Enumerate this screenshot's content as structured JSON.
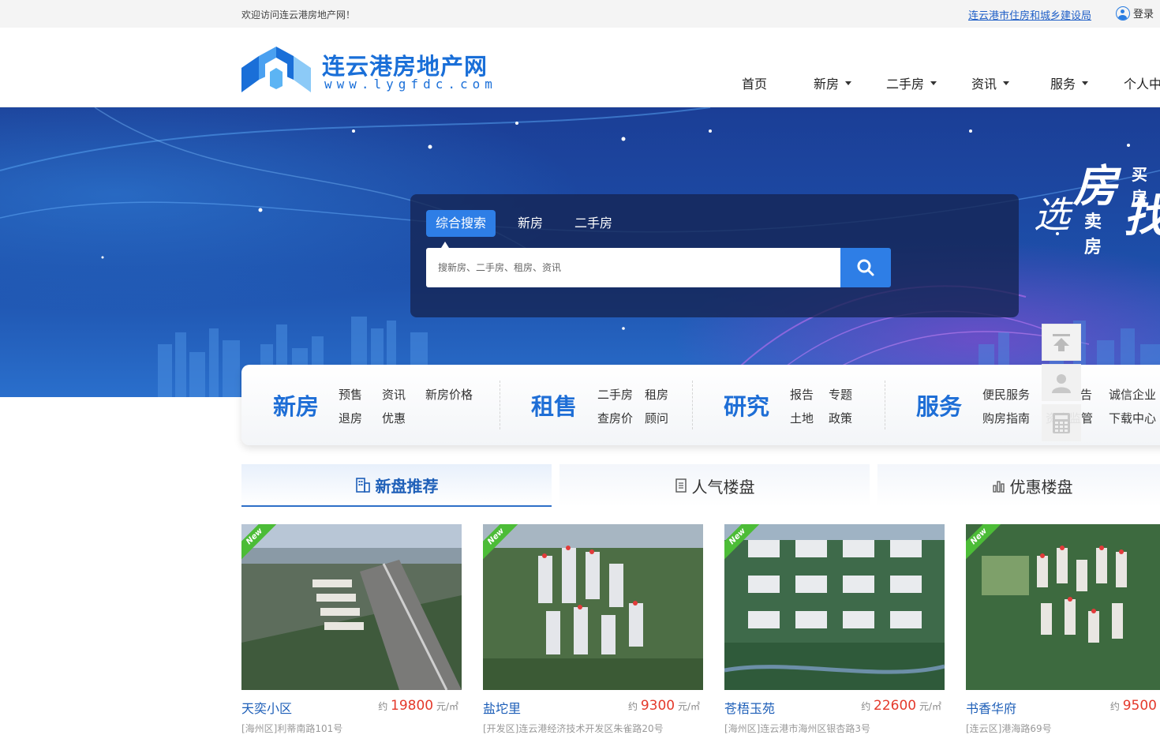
{
  "topbar": {
    "welcome": "欢迎访问连云港房地产网！",
    "gov_link": "连云港市住房和城乡建设局",
    "login": "登录"
  },
  "header": {
    "logo_title": "连云港房地产网",
    "logo_sub": "www.lygfdc.com",
    "nav": [
      "首页",
      "新房",
      "二手房",
      "资讯",
      "服务",
      "个人中"
    ]
  },
  "banner": {
    "slogan": {
      "big1": "房",
      "sm1": "买房",
      "big2": "选",
      "sm2": "卖房",
      "big3": "找"
    }
  },
  "search": {
    "tabs": [
      "综合搜索",
      "新房",
      "二手房"
    ],
    "active_tab": "综合搜索",
    "placeholder": "搜新房、二手房、租房、资讯",
    "button_icon": "search-icon"
  },
  "categories": [
    {
      "title": "新房",
      "links": [
        "预售",
        "资讯",
        "新房价格",
        "退房",
        "优惠"
      ]
    },
    {
      "title": "租售",
      "links": [
        "二手房",
        "租房",
        "查房价",
        "顾问"
      ]
    },
    {
      "title": "研究",
      "links": [
        "报告",
        "专题",
        "土地",
        "政策"
      ]
    },
    {
      "title": "服务",
      "links": [
        "便民服务",
        "告",
        "诚信企业",
        "购房指南",
        "资金监管",
        "下载中心"
      ]
    }
  ],
  "float_icons": [
    "back-to-top-icon",
    "user-icon",
    "calculator-icon"
  ],
  "rec_tabs": [
    {
      "label": "新盘推荐",
      "icon": "building-icon",
      "active": true
    },
    {
      "label": "人气楼盘",
      "icon": "document-icon",
      "active": false
    },
    {
      "label": "优惠楼盘",
      "icon": "chart-icon",
      "active": false
    }
  ],
  "listings": [
    {
      "name": "天奕小区",
      "price_prefix": "约",
      "price": "19800",
      "unit": "元/㎡",
      "address": "[海州区]利蒂南路101号",
      "tag": "New"
    },
    {
      "name": "盐坨里",
      "price_prefix": "约",
      "price": "9300",
      "unit": "元/㎡",
      "address": "[开发区]连云港经济技术开发区朱雀路20号",
      "tag": "New"
    },
    {
      "name": "苍梧玉苑",
      "price_prefix": "约",
      "price": "22600",
      "unit": "元/㎡",
      "address": "[海州区]连云港市海州区银杏路3号",
      "tag": "New"
    },
    {
      "name": "书香华府",
      "price_prefix": "约",
      "price": "9500",
      "unit": "",
      "address": "[连云区]港海路69号",
      "tag": "New"
    }
  ],
  "colors": {
    "brand": "#1a6fd8",
    "accent": "#2e7ee6",
    "price": "#e4392b",
    "new_tag": "#4cbc37"
  }
}
